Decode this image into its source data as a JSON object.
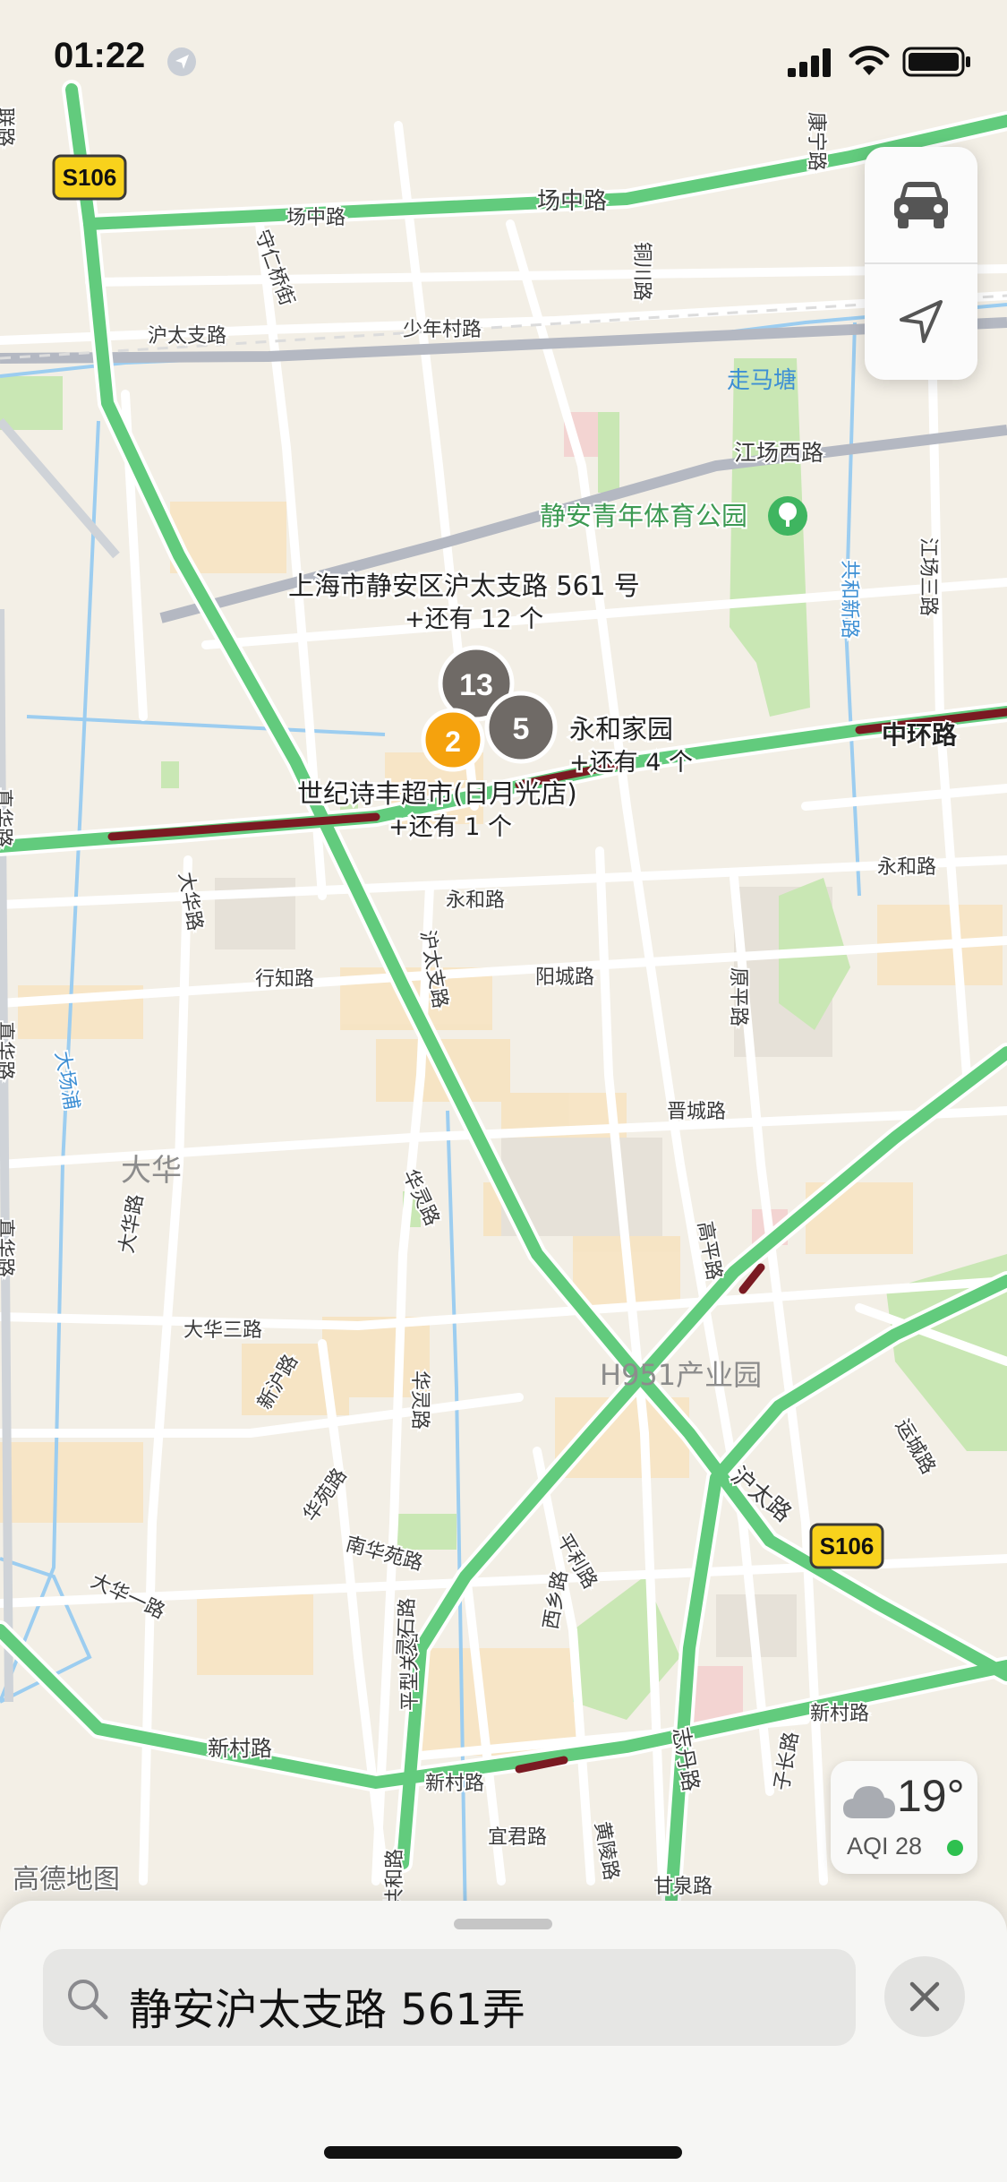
{
  "status_bar": {
    "time": "01:22"
  },
  "map": {
    "road_labels": [
      "场中路",
      "场中路",
      "守仁桥街",
      "沪太支路",
      "少年村路",
      "康宁路",
      "铜川路",
      "江场西路",
      "江场三路",
      "共和新路",
      "中环路",
      "真华路",
      "大华路",
      "永和路",
      "永和路",
      "行知路",
      "阳城路",
      "沪太支路",
      "晋城路",
      "原平路",
      "高平路",
      "华灵路",
      "大华三路",
      "新沪路",
      "华灵路",
      "大华路",
      "大华一路",
      "华苑路",
      "南华苑路",
      "平型关路",
      "平利路",
      "西乡路",
      "新村路",
      "新村路",
      "宜君路",
      "黄陵路",
      "甘泉路",
      "志丹路",
      "子长路",
      "新村路",
      "沪太路",
      "运城路",
      "真华路",
      "真华路",
      "大场浦",
      "联路",
      "灵石路",
      "共和路"
    ],
    "area_labels": [
      "大华",
      "H951产业园"
    ],
    "highway_shields": [
      "S106",
      "S106"
    ],
    "poi": {
      "park_name": "静安青年体育公园",
      "water_label": "走马塘"
    },
    "callouts": [
      {
        "title": "上海市静安区沪太支路 561 号",
        "more": "+还有 12 个"
      },
      {
        "title": "永和家园",
        "more": "+还有 4 个"
      },
      {
        "title": "世纪诗丰超市(日月光店)",
        "more": "+还有 1 个"
      }
    ],
    "clusters": [
      "13",
      "5",
      "2"
    ],
    "attribution": "高德地图"
  },
  "controls": {
    "car_icon": "car-icon",
    "location_icon": "location-arrow-icon"
  },
  "weather": {
    "temperature": "19°",
    "aqi": "AQI 28",
    "aqi_color": "#2ec04f"
  },
  "search": {
    "query": "静安沪太支路 561弄"
  },
  "colors": {
    "traffic_green": "#62cb7d",
    "traffic_red": "#7a1a22",
    "park": "#c9e7b4",
    "water": "#8ec7ef",
    "cluster_orange": "#f5a20d",
    "cluster_gray": "#6f6a66",
    "shield": "#f8d21c"
  }
}
